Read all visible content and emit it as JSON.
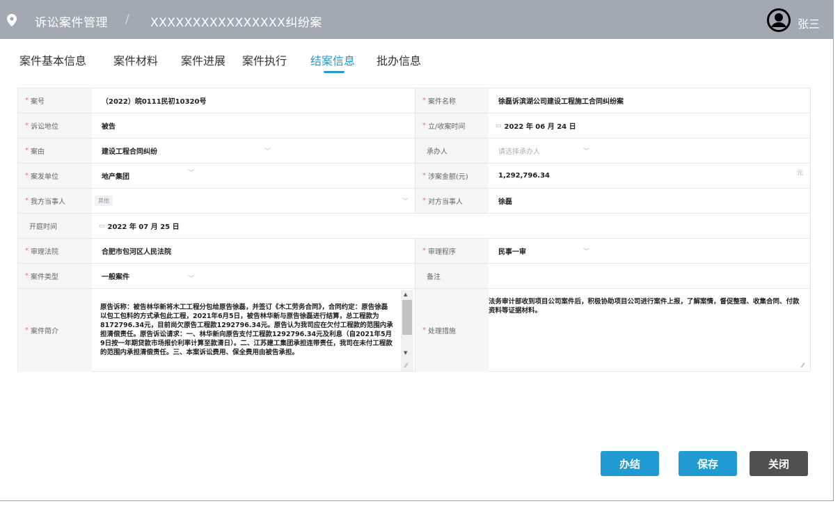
{
  "header": {
    "breadcrumb_root": "诉讼案件管理",
    "breadcrumb_sep": "/",
    "breadcrumb_case": "XXXXXXXXXXXXXXXX纠纷案",
    "user_name": "张三"
  },
  "tabs": [
    {
      "label": "案件基本信息"
    },
    {
      "label": "案件材料"
    },
    {
      "label": "案件进展"
    },
    {
      "label": "案件执行"
    },
    {
      "label": "结案信息"
    },
    {
      "label": "批办信息"
    }
  ],
  "active_tab": "结案信息",
  "form": {
    "case_no_label": "案号",
    "case_no": "（2022）皖0111民初10320号",
    "case_name_label": "案件名称",
    "case_name": "徐磊诉滨湖公司建设工程施工合同纠纷案",
    "litigation_position_label": "诉讼地位",
    "litigation_position": "被告",
    "filing_date_label": "立/收案时间",
    "filing_date": "2022 年 06 月 24 日",
    "cause_label": "案由",
    "cause": "建设工程合同纠纷",
    "handler_label": "承办人",
    "handler_placeholder": "请选择承办人",
    "unit_label": "案发单位",
    "unit": "地产集团",
    "amount_label": "涉案金额(元)",
    "amount": "1,292,796.34",
    "amount_unit": "元",
    "our_party_label": "我方当事人",
    "our_party_tag": "其他",
    "opposing_party_label": "对方当事人",
    "opposing_party": "徐磊",
    "hearing_date_label": "开庭时间",
    "hearing_date": "2022 年 07 月 25 日",
    "court_label": "审理法院",
    "court": "合肥市包河区人民法院",
    "procedure_label": "审理程序",
    "procedure": "民事一审",
    "case_type_label": "案件类型",
    "case_type": "一般案件",
    "remark_label": "备注",
    "summary_label": "案件简介",
    "summary": "原告诉称：被告林华新将木工工程分包给原告徐磊，并签订《木工劳务合同》，合同约定：原告徐磊以包工包料的方式承包此工程，2021年6月5日，被告林华新与原告徐磊进行结算，总工程款为8172796.34元，目前尚欠原告工程款1292796.34元。原告认为我司应在欠付工程款的范围内承担清偿责任。原告诉讼请求：一、林华新向原告支付工程款1292796.34元及利息（自2021年5月9日按一年期贷款市场报价利率计算至款清日）。二、江苏建工集团承担连带责任，我司在未付工程款的范围内承担清偿责任。三、本案诉讼费用、保全费用由被告承担。",
    "measures_label": "处理措施",
    "measures": "法务审计部收到项目公司案件后，积极协助项目公司进行案件上报，了解案情，督促整理、收集合同、付款资料等证据材料。"
  },
  "buttons": {
    "finish": "办结",
    "save": "保存",
    "close": "关闭"
  },
  "colors": {
    "topbar": "#a2a9b3",
    "accent": "#1f9bd1",
    "close_button": "#505050",
    "required": "#f56c6c"
  }
}
